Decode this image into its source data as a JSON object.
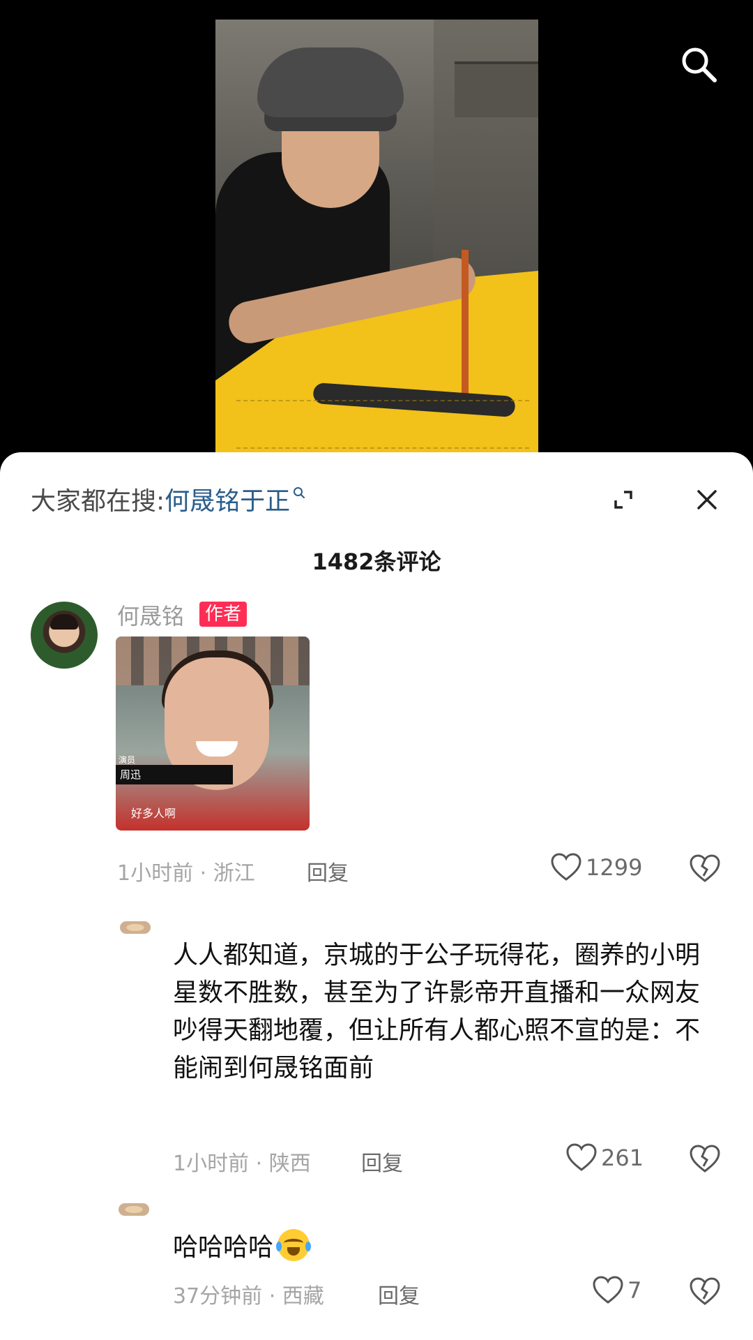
{
  "top_bar": {
    "search_icon": "search-icon"
  },
  "sheet": {
    "suggest_label": "大家都在搜:",
    "suggest_query": "何晟铭于正",
    "comment_count": "1482条评论"
  },
  "comments": [
    {
      "username": "何晟铭",
      "badge": "作者",
      "image_tag_small": "演员",
      "image_tag_name": "周迅",
      "image_caption": "好多人啊",
      "time_location": "1小时前 · 浙江",
      "reply_label": "回复",
      "likes": "1299"
    },
    {
      "text": "人人都知道，京城的于公子玩得花，圈养的小明星数不胜数，甚至为了许影帝开直播和一众网友吵得天翻地覆，但让所有人都心照不宣的是：不能闹到何晟铭面前",
      "time_location": "1小时前 · 陕西",
      "reply_label": "回复",
      "likes": "261"
    },
    {
      "text": "哈哈哈哈",
      "time_location": "37分钟前 · 西藏",
      "reply_label": "回复",
      "likes": "7"
    }
  ]
}
